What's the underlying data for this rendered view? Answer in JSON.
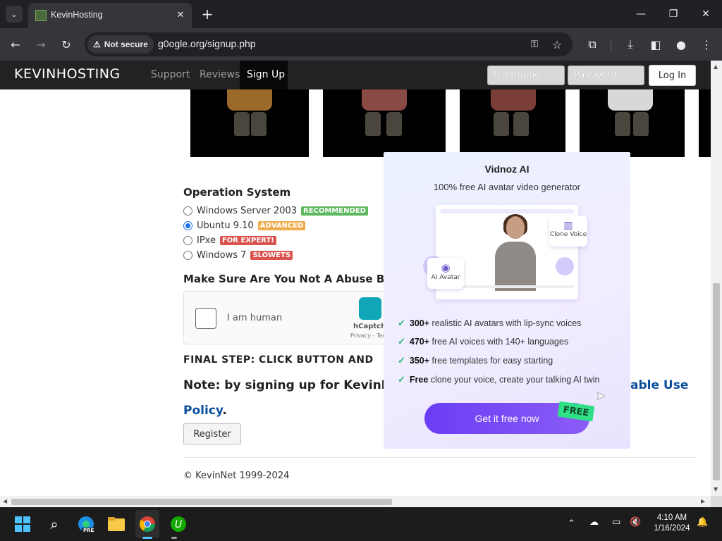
{
  "browser": {
    "tab_title": "KevinHosting",
    "not_secure": "Not secure",
    "url": "g0ogle.org/signup.php"
  },
  "site": {
    "brand": "KEVINHOSTING",
    "nav": [
      "Support",
      "Reviews",
      "Sign Up"
    ],
    "username_placeholder": "Username",
    "password_placeholder": "Password",
    "login_label": "Log In"
  },
  "form": {
    "os_heading": "Operation System",
    "options": [
      {
        "name": "Windows Server 2003",
        "badge": "RECOMMENDED",
        "badge_color": "#5cb85c",
        "selected": false
      },
      {
        "name": "Ubuntu 9.10",
        "badge": "ADVANCED",
        "badge_color": "#f0ad4e",
        "selected": true
      },
      {
        "name": "IPxe",
        "badge": "FOR EXPERT!",
        "badge_color": "#d9534f",
        "selected": false
      },
      {
        "name": "Windows 7",
        "badge": "SLOWETS",
        "badge_color": "#d9534f",
        "selected": false
      }
    ],
    "abuse_heading": "Make Sure Are You Not A Abuse Bo",
    "captcha_label": "I am human",
    "captcha_brand": "hCaptcha",
    "captcha_terms": "Privacy - Terms",
    "final_step": "FINAL STEP: CLICK BUTTON AND",
    "note_prefix": "Note: by signing up for KevinHos",
    "note_link_1": "able Use",
    "note_link_2": "Policy",
    "note_suffix": ".",
    "register_label": "Register",
    "copyright": "© KevinNet 1999-2024"
  },
  "ad": {
    "title": "Vidnoz AI",
    "subtitle": "100% free AI avatar video generator",
    "clone_voice": "Clone Voice",
    "ai_avatar": "AI Avatar",
    "features": [
      {
        "bold": "300+",
        "text": " realistic AI avatars with lip-sync voices"
      },
      {
        "bold": "470+",
        "text": " free AI voices with 140+ languages"
      },
      {
        "bold": "350+",
        "text": " free templates for easy starting"
      },
      {
        "bold": "Free",
        "text": " clone your voice, create your talking AI twin"
      }
    ],
    "cta": "Get it free now",
    "free_tag": "FREE"
  },
  "taskbar": {
    "time": "4:10 AM",
    "date": "1/16/2024",
    "pre_badge": "PRE"
  }
}
